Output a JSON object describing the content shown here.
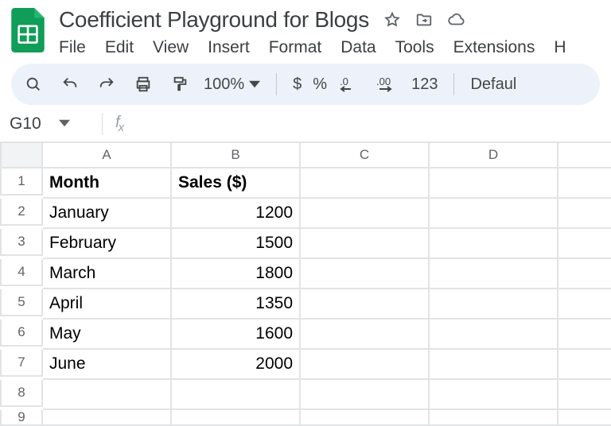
{
  "doc": {
    "title": "Coefficient Playground for Blogs"
  },
  "menu": {
    "file": "File",
    "edit": "Edit",
    "view": "View",
    "insert": "Insert",
    "format": "Format",
    "data": "Data",
    "tools": "Tools",
    "extensions": "Extensions",
    "help": "H"
  },
  "toolbar": {
    "zoom": "100%",
    "currency": "$",
    "percent": "%",
    "num_format": "123",
    "font": "Defaul"
  },
  "formula": {
    "name_box": "G10"
  },
  "sheet": {
    "columns": [
      "A",
      "B",
      "C",
      "D",
      ""
    ],
    "rows": [
      "1",
      "2",
      "3",
      "4",
      "5",
      "6",
      "7",
      "8",
      "9"
    ],
    "headers": {
      "a": "Month",
      "b": "Sales ($)"
    },
    "data": [
      {
        "month": "January",
        "sales": "1200"
      },
      {
        "month": "February",
        "sales": "1500"
      },
      {
        "month": "March",
        "sales": "1800"
      },
      {
        "month": "April",
        "sales": "1350"
      },
      {
        "month": "May",
        "sales": "1600"
      },
      {
        "month": "June",
        "sales": "2000"
      }
    ]
  },
  "chart_data": {
    "type": "table",
    "title": "Sales ($)",
    "categories": [
      "January",
      "February",
      "March",
      "April",
      "May",
      "June"
    ],
    "values": [
      1200,
      1500,
      1800,
      1350,
      1600,
      2000
    ],
    "xlabel": "Month",
    "ylabel": "Sales ($)"
  }
}
